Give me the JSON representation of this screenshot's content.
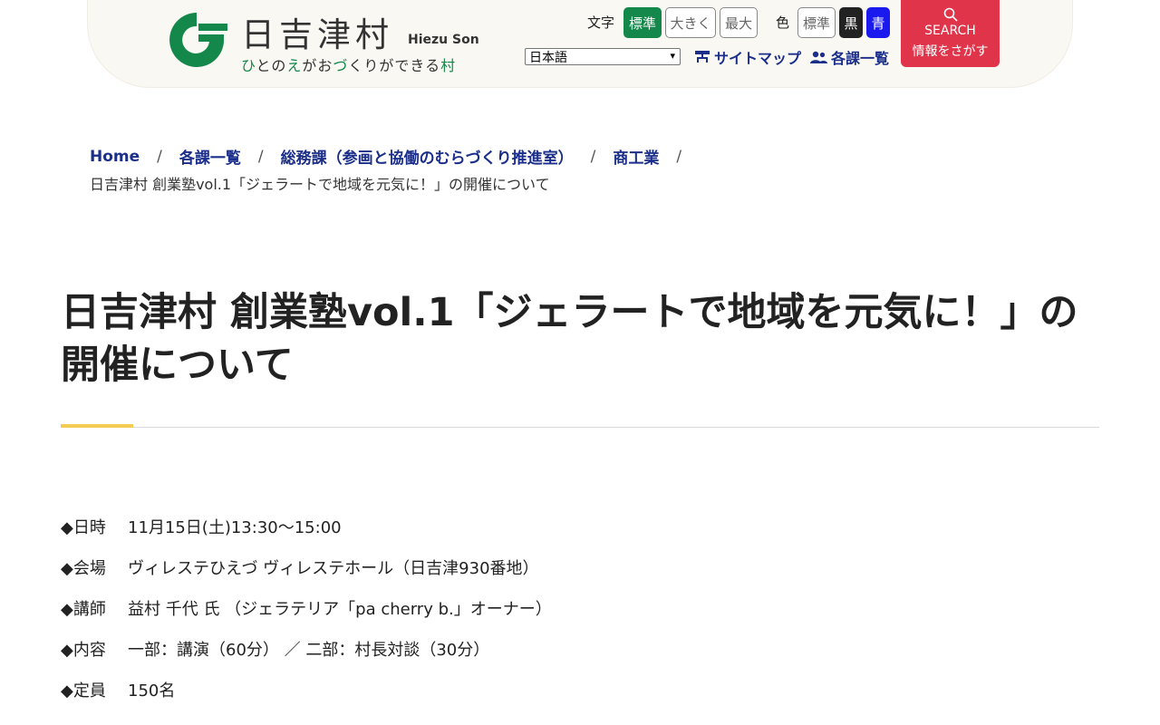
{
  "header": {
    "site_name": "日吉津村",
    "site_name_roman": "Hiezu Son",
    "tagline_parts": [
      {
        "text": "ひ",
        "green": true
      },
      {
        "text": "との",
        "green": false
      },
      {
        "text": "え",
        "green": true
      },
      {
        "text": "がお",
        "green": false
      },
      {
        "text": "づ",
        "green": true
      },
      {
        "text": "くりができる",
        "green": false
      },
      {
        "text": "村",
        "green": true
      }
    ],
    "text_size_label": "文字",
    "text_size_options": [
      "標準",
      "大きく",
      "最大"
    ],
    "color_label": "色",
    "color_options": [
      "標準",
      "黒",
      "青"
    ],
    "language_selected": "日本語",
    "sitemap_label": "サイトマップ",
    "departments_label": "各課一覧",
    "search_label": "SEARCH",
    "search_sub_label": "情報をさがす",
    "colors": {
      "brand_green": "#14884a",
      "link_navy": "#1b2f8a",
      "search_red": "#e0344a",
      "accent_yellow": "#f3cc55"
    }
  },
  "breadcrumb": {
    "items": [
      "Home",
      "各課一覧",
      "総務課（参画と協働のむらづくり推進室）",
      "商工業"
    ],
    "current": "日吉津村 創業塾vol.1「ジェラートで地域を元気に！」の開催について"
  },
  "page": {
    "title": "日吉津村 創業塾vol.1「ジェラートで地域を元気に！」の開催について",
    "details": [
      {
        "label": "◆日時",
        "value": "11月15日(土)13:30～15:00"
      },
      {
        "label": "◆会場",
        "value": "ヴィレステひえづ ヴィレステホール（日吉津930番地）"
      },
      {
        "label": "◆講師",
        "value": "益村 千代 氏 （ジェラテリア「pa cherry b.」オーナー）"
      },
      {
        "label": "◆内容",
        "value": "一部：講演（60分） ／ 二部：村長対談（30分）"
      },
      {
        "label": "◆定員",
        "value": "150名"
      }
    ]
  }
}
